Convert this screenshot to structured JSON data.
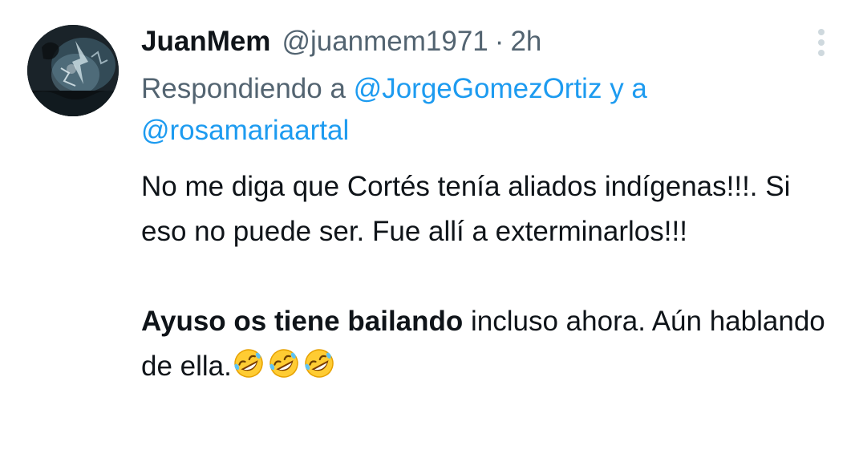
{
  "tweet": {
    "author": {
      "display_name": "JuanMem",
      "handle": "@juanmem1971",
      "separator": "·",
      "time": "2h",
      "avatar_icon": "profile-avatar"
    },
    "menu_icon": "more-vertical-icon",
    "reply_context": {
      "prefix": "Respondiendo a",
      "mention_1": "@JorgeGomezOrtiz",
      "joiner": "y a",
      "mention_2": "@rosamariaartal"
    },
    "body": {
      "paragraph_1": "No me diga que Cortés tenía aliados indígenas!!!. Si eso no puede ser. Fue allí a exterminarlos!!!",
      "paragraph_2_bold": "Ayuso os tiene bailando",
      "paragraph_2_rest": " incluso ahora. Aún hablando de ella.",
      "emojis": [
        "rolling-on-floor-laughing-emoji",
        "rolling-on-floor-laughing-emoji",
        "rolling-on-floor-laughing-emoji"
      ]
    },
    "colors": {
      "text": "#0f1419",
      "secondary": "#536471",
      "link": "#1d9bf0",
      "icon": "#cfd9de"
    }
  }
}
